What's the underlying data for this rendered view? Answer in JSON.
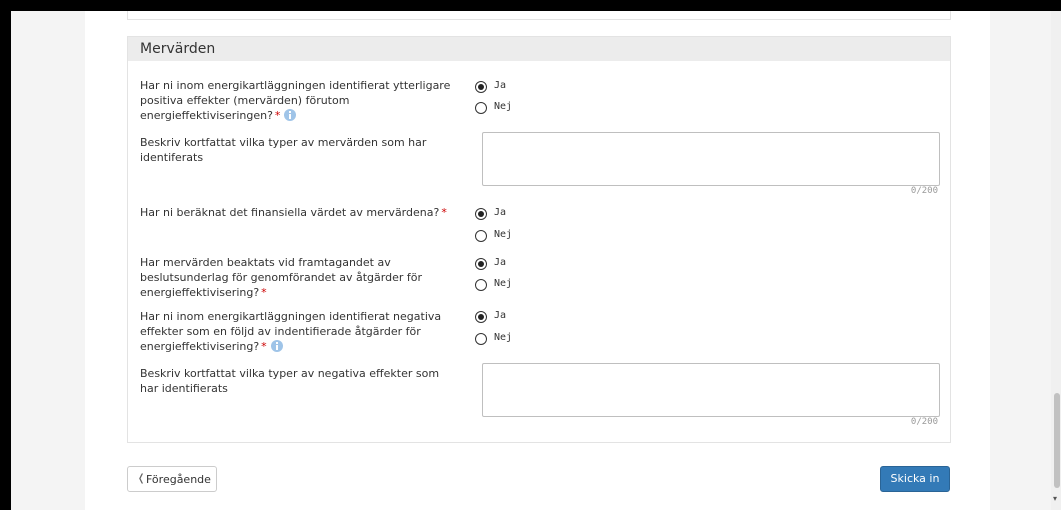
{
  "section": {
    "title": "Mervärden"
  },
  "questions": [
    {
      "label": "Har ni inom energikartläggningen identifierat ytterligare positiva effekter (mervärden) förutom energieffektiviseringen?",
      "required": "*",
      "has_info": true,
      "options": [
        {
          "label": "Ja",
          "checked": true
        },
        {
          "label": "Nej",
          "checked": false
        }
      ]
    },
    {
      "label": "Beskriv kortfattat vilka typer av mervärden som har identiferats",
      "textarea_value": "",
      "counter": "0/200"
    },
    {
      "label": "Har ni beräknat det finansiella värdet av mervärdena?",
      "required": "*",
      "options": [
        {
          "label": "Ja",
          "checked": true
        },
        {
          "label": "Nej",
          "checked": false
        }
      ]
    },
    {
      "label": "Har mervärden beaktats vid framtagandet av beslutsunderlag för genomförandet av åtgärder för energieffektivisering?",
      "required": "*",
      "options": [
        {
          "label": "Ja",
          "checked": true
        },
        {
          "label": "Nej",
          "checked": false
        }
      ]
    },
    {
      "label": "Har ni inom energikartläggningen identifierat negativa effekter som en följd av indentifierade åtgärder för energieffektivisering?",
      "required": "*",
      "has_info": true,
      "options": [
        {
          "label": "Ja",
          "checked": true
        },
        {
          "label": "Nej",
          "checked": false
        }
      ]
    },
    {
      "label": "Beskriv kortfattat vilka typer av negativa effekter som har identifierats",
      "textarea_value": "",
      "counter": "0/200"
    }
  ],
  "footer": {
    "prev_label": "Föregående",
    "prev_icon": "chevron-left-icon",
    "submit_label": "Skicka in"
  },
  "colors": {
    "primary": "#337ab7",
    "required": "#cc0000",
    "info": "#9fc4e8",
    "heading_bg": "#ececec"
  }
}
